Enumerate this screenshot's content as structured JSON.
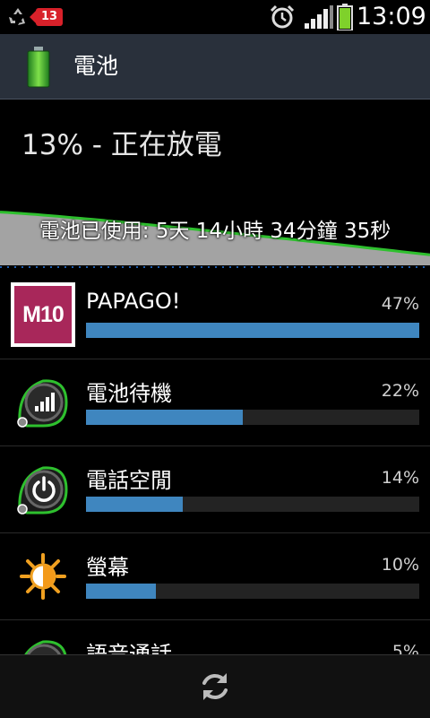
{
  "status_bar": {
    "notification_badge": "13",
    "time": "13:09",
    "icons": [
      "recycle-icon",
      "notification-badge-icon",
      "alarm-icon",
      "signal-icon",
      "battery-status-icon"
    ]
  },
  "title_bar": {
    "title": "電池",
    "icon": "battery-icon"
  },
  "battery": {
    "status": "13% - 正在放電",
    "usage_time": "電池已使用: 5天 14小時 34分鐘 35秒",
    "graph_level_start": 0.66,
    "graph_level_end": 0.13
  },
  "usage_list": [
    {
      "name": "PAPAGO!",
      "percent": "47%",
      "fraction": 1.0,
      "icon": "papago-m10-icon",
      "icon_text": "M10"
    },
    {
      "name": "電池待機",
      "percent": "22%",
      "fraction": 0.47,
      "icon": "cell-standby-icon"
    },
    {
      "name": "電話空閒",
      "percent": "14%",
      "fraction": 0.29,
      "icon": "phone-idle-icon"
    },
    {
      "name": "螢幕",
      "percent": "10%",
      "fraction": 0.21,
      "icon": "brightness-icon"
    },
    {
      "name": "語音通話",
      "percent": "5%",
      "fraction": 0.1,
      "icon": "voice-call-icon"
    }
  ],
  "bottom_bar": {
    "icon": "refresh-icon"
  },
  "colors": {
    "title_bar_bg": "#29303b",
    "progress_fill": "#3f86bf",
    "progress_track": "#232323",
    "graph_line": "#2ec02e",
    "graph_fill": "#a3a3a3"
  }
}
